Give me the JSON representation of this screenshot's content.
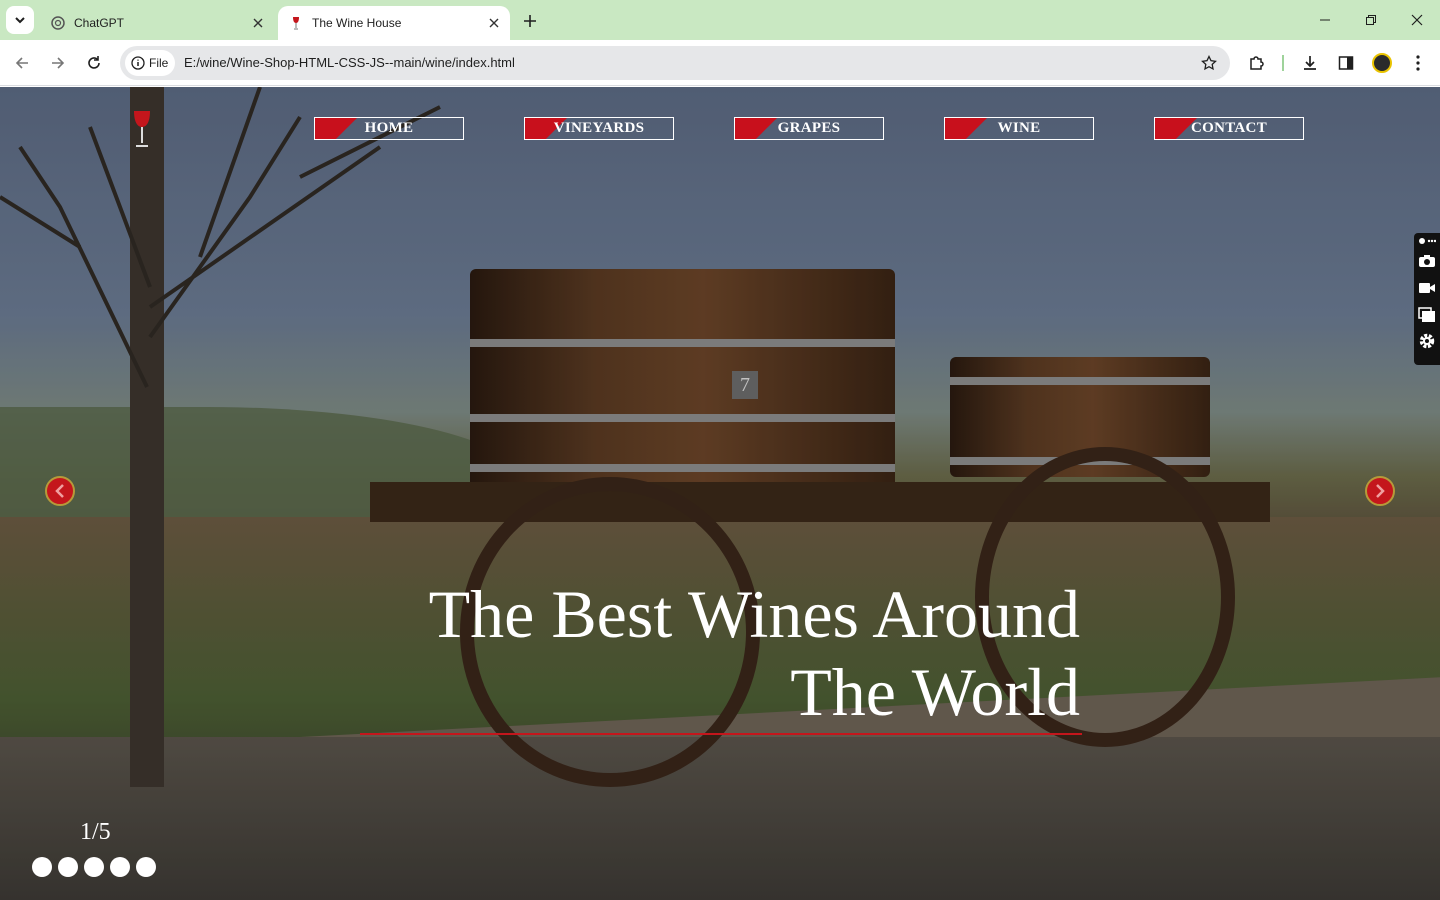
{
  "browser": {
    "tabs": [
      {
        "title": "ChatGPT",
        "active": false
      },
      {
        "title": "The Wine House",
        "active": true
      }
    ],
    "address": {
      "chip_label": "File",
      "url": "E:/wine/Wine-Shop-HTML-CSS-JS--main/wine/index.html"
    }
  },
  "site": {
    "nav": [
      "HOME",
      "VINEYARDS",
      "GRAPES",
      "WINE",
      "CONTACT"
    ],
    "hero": {
      "line1": "The Best Wines Around",
      "line2": "The World"
    },
    "slider": {
      "counter": "1/5",
      "total_dots": 5
    },
    "colors": {
      "accent": "#c4161c",
      "tabbar": "#c9e8c2"
    }
  }
}
